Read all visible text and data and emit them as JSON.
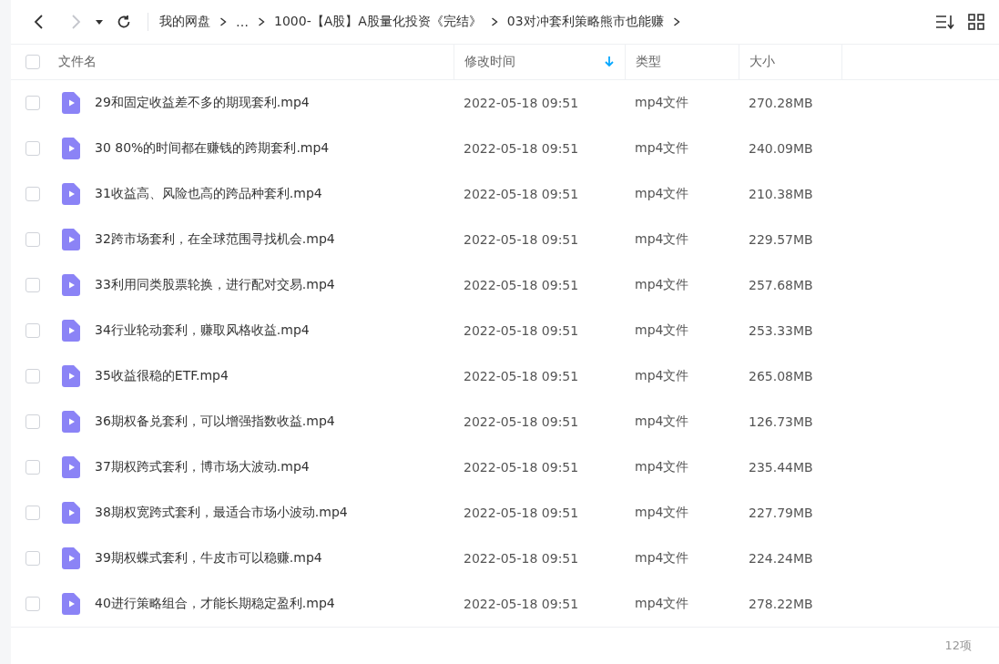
{
  "toolbar": {
    "back_disabled": false,
    "forward_disabled": true,
    "breadcrumb": [
      "我的网盘",
      "…",
      "1000-【A股】A股量化投资《完结》",
      "03对冲套利策略熊市也能赚"
    ]
  },
  "table": {
    "all_checked": false,
    "columns": [
      {
        "label": "文件名",
        "sorted": false
      },
      {
        "label": "修改时间",
        "sorted": true
      },
      {
        "label": "类型",
        "sorted": false
      },
      {
        "label": "大小",
        "sorted": false
      }
    ],
    "rows": [
      {
        "name": "29和固定收益差不多的期现套利.mp4",
        "modified": "2022-05-18 09:51",
        "type": "mp4文件",
        "size": "270.28MB",
        "checked": false
      },
      {
        "name": "30 80%的时间都在赚钱的跨期套利.mp4",
        "modified": "2022-05-18 09:51",
        "type": "mp4文件",
        "size": "240.09MB",
        "checked": false
      },
      {
        "name": "31收益高、风险也高的跨品种套利.mp4",
        "modified": "2022-05-18 09:51",
        "type": "mp4文件",
        "size": "210.38MB",
        "checked": false
      },
      {
        "name": "32跨市场套利，在全球范围寻找机会.mp4",
        "modified": "2022-05-18 09:51",
        "type": "mp4文件",
        "size": "229.57MB",
        "checked": false
      },
      {
        "name": "33利用同类股票轮换，进行配对交易.mp4",
        "modified": "2022-05-18 09:51",
        "type": "mp4文件",
        "size": "257.68MB",
        "checked": false
      },
      {
        "name": "34行业轮动套利，赚取风格收益.mp4",
        "modified": "2022-05-18 09:51",
        "type": "mp4文件",
        "size": "253.33MB",
        "checked": false
      },
      {
        "name": "35收益很稳的ETF.mp4",
        "modified": "2022-05-18 09:51",
        "type": "mp4文件",
        "size": "265.08MB",
        "checked": false
      },
      {
        "name": "36期权备兑套利，可以增强指数收益.mp4",
        "modified": "2022-05-18 09:51",
        "type": "mp4文件",
        "size": "126.73MB",
        "checked": false
      },
      {
        "name": "37期权跨式套利，博市场大波动.mp4",
        "modified": "2022-05-18 09:51",
        "type": "mp4文件",
        "size": "235.44MB",
        "checked": false
      },
      {
        "name": "38期权宽跨式套利，最适合市场小波动.mp4",
        "modified": "2022-05-18 09:51",
        "type": "mp4文件",
        "size": "227.79MB",
        "checked": false
      },
      {
        "name": "39期权蝶式套利，牛皮市可以稳赚.mp4",
        "modified": "2022-05-18 09:51",
        "type": "mp4文件",
        "size": "224.24MB",
        "checked": false
      },
      {
        "name": "40进行策略组合，才能长期稳定盈利.mp4",
        "modified": "2022-05-18 09:51",
        "type": "mp4文件",
        "size": "278.22MB",
        "checked": false
      }
    ]
  },
  "footer": {
    "count": "12项"
  }
}
